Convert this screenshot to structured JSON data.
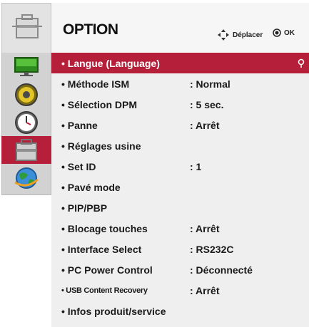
{
  "header": {
    "title": "OPTION",
    "hint_move": "Déplacer",
    "hint_ok": "OK"
  },
  "sidebar": {
    "items": [
      {
        "icon": "monitor-icon"
      },
      {
        "icon": "speaker-icon"
      },
      {
        "icon": "clock-icon"
      },
      {
        "icon": "toolbox-icon",
        "active": true
      },
      {
        "icon": "globe-icon"
      }
    ]
  },
  "menu": {
    "items": [
      {
        "label": "• Langue (Language)",
        "value": ""
      },
      {
        "label": "• Méthode ISM",
        "value": ": Normal"
      },
      {
        "label": "• Sélection DPM",
        "value": ": 5 sec."
      },
      {
        "label": "• Panne",
        "value": ": Arrêt"
      },
      {
        "label": "• Réglages usine",
        "value": ""
      },
      {
        "label": "• Set ID",
        "value": ": 1"
      },
      {
        "label": "• Pavé mode",
        "value": ""
      },
      {
        "label": "• PIP/PBP",
        "value": ""
      },
      {
        "label": "• Blocage touches",
        "value": ": Arrêt"
      },
      {
        "label": "• Interface Select",
        "value": ": RS232C"
      },
      {
        "label": "• PC Power Control",
        "value": ": Déconnecté"
      },
      {
        "label": "• USB Content Recovery",
        "value": ": Arrêt"
      },
      {
        "label": "• Infos produit/service",
        "value": ""
      }
    ]
  },
  "colors": {
    "accent": "#b51f3a",
    "panel": "#efefef",
    "sidebar": "#d2d2d2"
  }
}
